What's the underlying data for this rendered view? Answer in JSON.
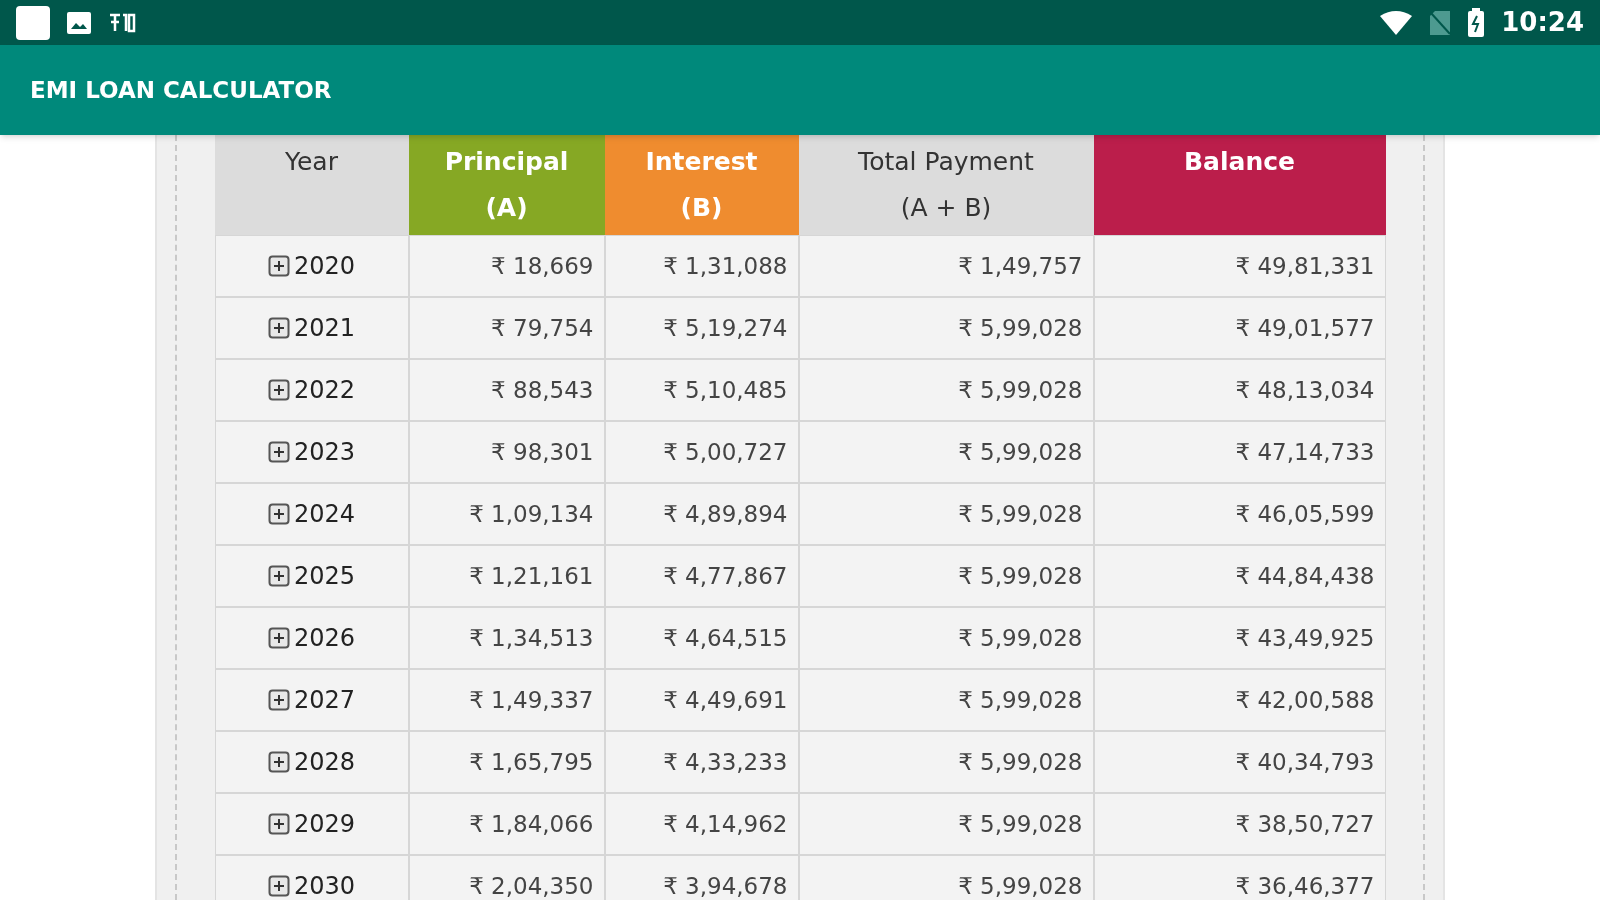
{
  "status_bar": {
    "time": "10:24"
  },
  "app_bar": {
    "title": "EMI LOAN CALCULATOR"
  },
  "table": {
    "columns": [
      {
        "label": "Year",
        "kind": "plain",
        "color": "#dcdcdc"
      },
      {
        "label": "Principal\n(A)",
        "kind": "highlighted",
        "color": "#86a824"
      },
      {
        "label": "Interest\n(B)",
        "kind": "highlighted",
        "color": "#ef8c2f"
      },
      {
        "label": "Total Payment\n(A + B)",
        "kind": "plain",
        "color": "#dcdcdc"
      },
      {
        "label": "Balance",
        "kind": "highlighted",
        "color": "#bb1e4b"
      }
    ],
    "rows": [
      {
        "expanded": false,
        "cells": [
          "2020",
          "₹ 18,669",
          "₹ 1,31,088",
          "₹ 1,49,757",
          "₹ 49,81,331"
        ]
      },
      {
        "expanded": false,
        "cells": [
          "2021",
          "₹ 79,754",
          "₹ 5,19,274",
          "₹ 5,99,028",
          "₹ 49,01,577"
        ]
      },
      {
        "expanded": false,
        "cells": [
          "2022",
          "₹ 88,543",
          "₹ 5,10,485",
          "₹ 5,99,028",
          "₹ 48,13,034"
        ]
      },
      {
        "expanded": false,
        "cells": [
          "2023",
          "₹ 98,301",
          "₹ 5,00,727",
          "₹ 5,99,028",
          "₹ 47,14,733"
        ]
      },
      {
        "expanded": false,
        "cells": [
          "2024",
          "₹ 1,09,134",
          "₹ 4,89,894",
          "₹ 5,99,028",
          "₹ 46,05,599"
        ]
      },
      {
        "expanded": false,
        "cells": [
          "2025",
          "₹ 1,21,161",
          "₹ 4,77,867",
          "₹ 5,99,028",
          "₹ 44,84,438"
        ]
      },
      {
        "expanded": false,
        "cells": [
          "2026",
          "₹ 1,34,513",
          "₹ 4,64,515",
          "₹ 5,99,028",
          "₹ 43,49,925"
        ]
      },
      {
        "expanded": false,
        "cells": [
          "2027",
          "₹ 1,49,337",
          "₹ 4,49,691",
          "₹ 5,99,028",
          "₹ 42,00,588"
        ]
      },
      {
        "expanded": false,
        "cells": [
          "2028",
          "₹ 1,65,795",
          "₹ 4,33,233",
          "₹ 5,99,028",
          "₹ 40,34,793"
        ]
      },
      {
        "expanded": false,
        "cells": [
          "2029",
          "₹ 1,84,066",
          "₹ 4,14,962",
          "₹ 5,99,028",
          "₹ 38,50,727"
        ]
      },
      {
        "expanded": false,
        "cells": [
          "2030",
          "₹ 2,04,350",
          "₹ 3,94,678",
          "₹ 5,99,028",
          "₹ 36,46,377"
        ]
      }
    ]
  }
}
